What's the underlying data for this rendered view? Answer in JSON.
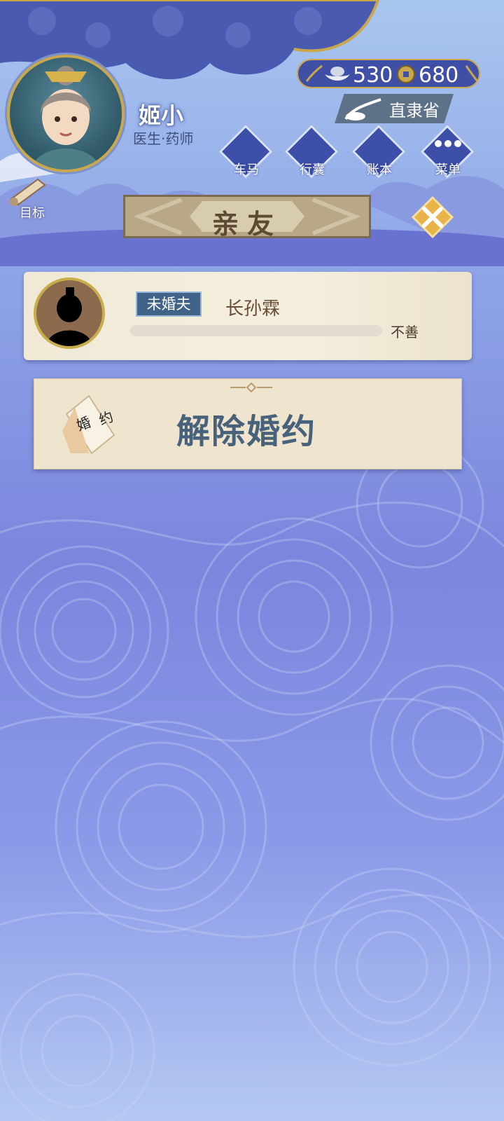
{
  "player": {
    "name": "姬小",
    "title": "医生·药师"
  },
  "currency": {
    "silver_icon": "silver-ingot-icon",
    "silver": "530",
    "coin_icon": "copper-coin-icon",
    "coins": "680"
  },
  "region": {
    "label": "直隶省"
  },
  "nav": [
    {
      "label": "车马",
      "icon": "carriage-icon"
    },
    {
      "label": "行囊",
      "icon": "bundle-icon"
    },
    {
      "label": "账本",
      "icon": "ledger-icon"
    },
    {
      "label": "菜单",
      "icon": "more-dots-icon"
    }
  ],
  "goal": {
    "label": "目标"
  },
  "panel": {
    "title": "亲友"
  },
  "friends": [
    {
      "relation": "未婚夫",
      "name": "长孙霖",
      "affinity_label": "不善"
    }
  ],
  "actions": {
    "break_engagement": "解除婚约",
    "contract_chars": [
      "婚",
      "约"
    ]
  },
  "colors": {
    "accent_gold": "#c9a84d",
    "panel_blue": "#3d4fa8",
    "text_brown": "#6a4d36"
  }
}
